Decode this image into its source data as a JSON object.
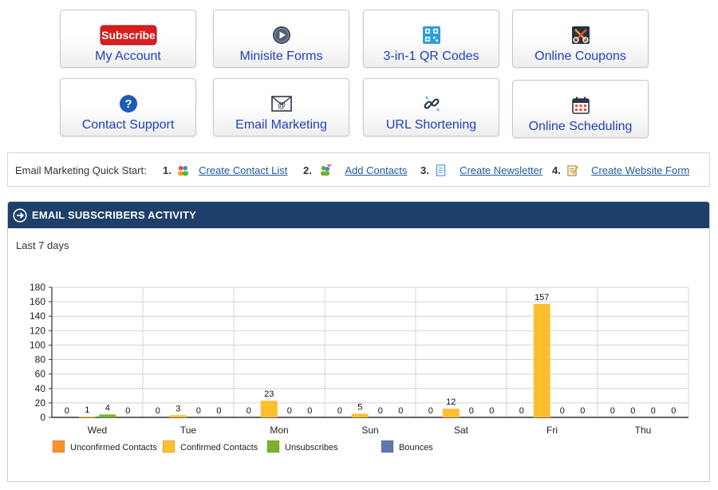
{
  "tiles": [
    {
      "label": "My Account",
      "icon": "subscribe-badge-icon",
      "badge_text": "Subscribe"
    },
    {
      "label": "Minisite Forms",
      "icon": "play-circle-icon"
    },
    {
      "label": "3-in-1 QR Codes",
      "icon": "qr-code-icon"
    },
    {
      "label": "Online Coupons",
      "icon": "scissors-coupon-icon"
    },
    {
      "label": "Contact Support",
      "icon": "help-circle-icon"
    },
    {
      "label": "Email Marketing",
      "icon": "envelope-at-icon"
    },
    {
      "label": "URL Shortening",
      "icon": "chain-link-icon"
    },
    {
      "label": "Online Scheduling",
      "icon": "calendar-icon"
    }
  ],
  "quickstart": {
    "label": "Email Marketing Quick Start:",
    "steps": [
      {
        "num": "1.",
        "link": "Create Contact List",
        "icon": "contacts-group-icon"
      },
      {
        "num": "2.",
        "link": "Add Contacts",
        "icon": "add-contacts-icon"
      },
      {
        "num": "3.",
        "link": "Create Newsletter",
        "icon": "newsletter-doc-icon"
      },
      {
        "num": "4.",
        "link": "Create Website Form",
        "icon": "website-form-icon"
      }
    ]
  },
  "panel": {
    "title": "EMAIL SUBSCRIBERS ACTIVITY",
    "range_label": "Last 7 days"
  },
  "colors": {
    "header_bg": "#1e3f6a",
    "link": "#1f5aa0",
    "tile_label": "#1f3fbf",
    "unconfirmed": "#f7922e",
    "confirmed": "#fdbf2d",
    "unsubscribes": "#7ab327",
    "bounces": "#6078b0"
  },
  "chart_data": {
    "type": "bar",
    "categories": [
      "Wed",
      "Tue",
      "Mon",
      "Sun",
      "Sat",
      "Fri",
      "Thu"
    ],
    "series": [
      {
        "name": "Unconfirmed Contacts",
        "values": [
          0,
          0,
          0,
          0,
          0,
          0,
          0
        ]
      },
      {
        "name": "Confirmed Contacts",
        "values": [
          1,
          3,
          23,
          5,
          12,
          157,
          0
        ]
      },
      {
        "name": "Unsubscribes",
        "values": [
          4,
          0,
          0,
          0,
          0,
          0,
          0
        ]
      },
      {
        "name": "Bounces",
        "values": [
          0,
          0,
          0,
          0,
          0,
          0,
          0
        ]
      }
    ],
    "ylim": [
      0,
      180
    ],
    "yticks": [
      0,
      20,
      40,
      60,
      80,
      100,
      120,
      140,
      160,
      180
    ],
    "grid": true,
    "legend": "bottom",
    "data_labels": true
  }
}
